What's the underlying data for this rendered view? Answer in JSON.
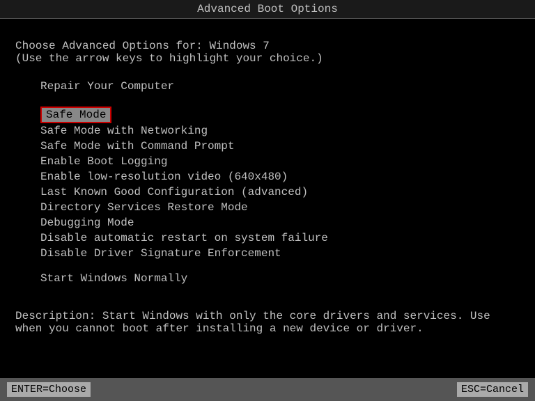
{
  "title_bar": {
    "text": "Advanced Boot Options"
  },
  "header": {
    "line1": "Choose Advanced Options for: Windows 7",
    "line2": "(Use the arrow keys to highlight your choice.)"
  },
  "menu": {
    "repair_label": "Repair Your Computer",
    "items": [
      {
        "id": "safe-mode",
        "label": "Safe Mode",
        "highlighted": true,
        "indented": false
      },
      {
        "id": "safe-mode-networking",
        "label": "Safe Mode with Networking",
        "highlighted": false,
        "indented": true
      },
      {
        "id": "safe-mode-command-prompt",
        "label": "Safe Mode with Command Prompt",
        "highlighted": false,
        "indented": true
      },
      {
        "id": "enable-boot-logging",
        "label": "Enable Boot Logging",
        "highlighted": false,
        "indented": true
      },
      {
        "id": "enable-low-res-video",
        "label": "Enable low-resolution video (640x480)",
        "highlighted": false,
        "indented": true
      },
      {
        "id": "last-known-good",
        "label": "Last Known Good Configuration (advanced)",
        "highlighted": false,
        "indented": true
      },
      {
        "id": "directory-services-restore",
        "label": "Directory Services Restore Mode",
        "highlighted": false,
        "indented": true
      },
      {
        "id": "debugging-mode",
        "label": "Debugging Mode",
        "highlighted": false,
        "indented": true
      },
      {
        "id": "disable-auto-restart",
        "label": "Disable automatic restart on system failure",
        "highlighted": false,
        "indented": true
      },
      {
        "id": "disable-driver-signature",
        "label": "Disable Driver Signature Enforcement",
        "highlighted": false,
        "indented": true
      },
      {
        "id": "start-windows-normally",
        "label": "Start Windows Normally",
        "highlighted": false,
        "indented": true
      }
    ]
  },
  "description": {
    "line1": "Description: Start Windows with only the core drivers and services. Use",
    "line2": "             when you cannot boot after installing a new device or driver."
  },
  "footer": {
    "left": "ENTER=Choose",
    "right": "ESC=Cancel"
  }
}
